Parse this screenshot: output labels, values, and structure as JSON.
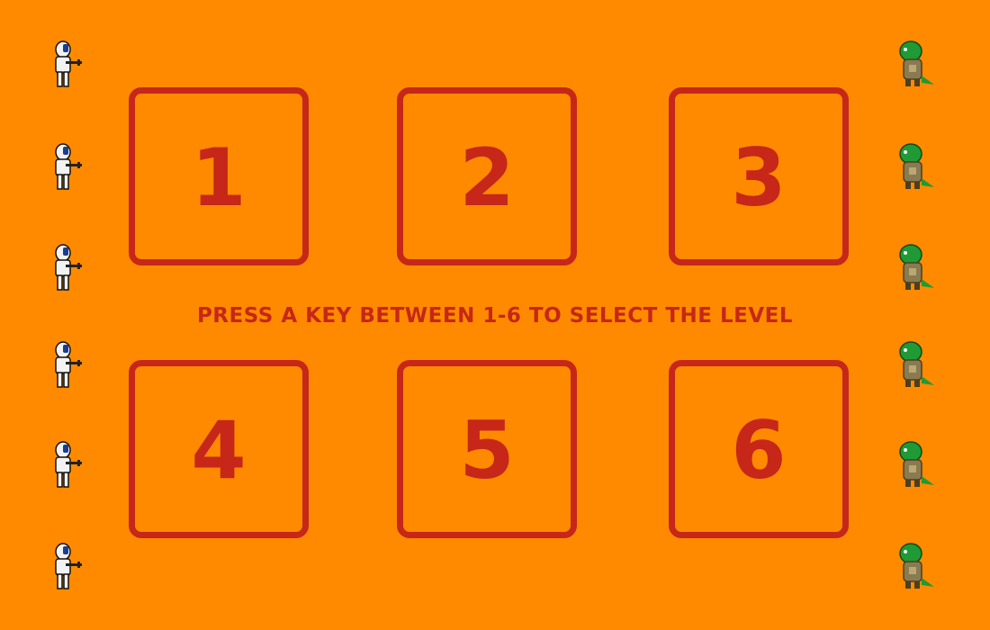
{
  "levels": [
    {
      "label": "1"
    },
    {
      "label": "2"
    },
    {
      "label": "3"
    },
    {
      "label": "4"
    },
    {
      "label": "5"
    },
    {
      "label": "6"
    }
  ],
  "instruction": "PRESS A KEY BETWEEN 1-6 TO SELECT THE LEVEL",
  "sprites": {
    "left": "astronaut-soldier-icon",
    "right": "green-dinosaur-icon"
  },
  "colors": {
    "background": "#ff8a00",
    "accent": "#c62718"
  }
}
